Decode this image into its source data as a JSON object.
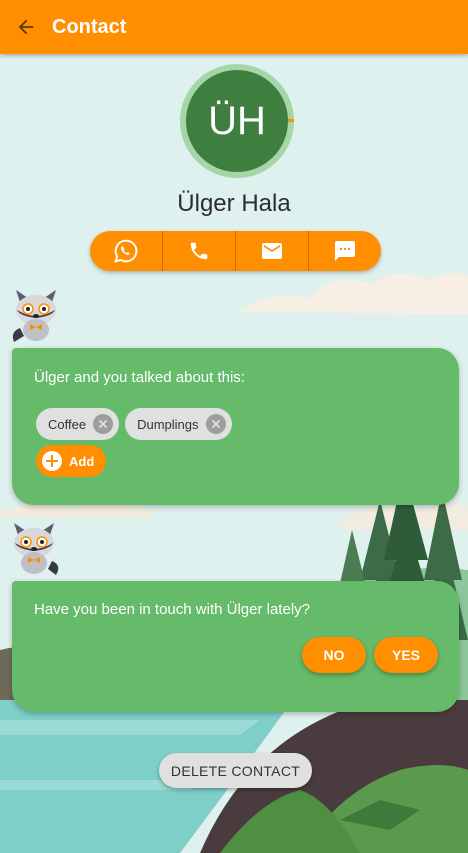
{
  "appbar": {
    "title": "Contact",
    "back_icon": "arrow-left-icon"
  },
  "contact": {
    "initials": "ÜH",
    "name": "Ülger Hala"
  },
  "actions": [
    {
      "icon": "whatsapp-icon"
    },
    {
      "icon": "phone-icon"
    },
    {
      "icon": "mail-icon"
    },
    {
      "icon": "sms-icon"
    }
  ],
  "topics_card": {
    "text": "Ülger and you talked about this:",
    "chips": [
      "Coffee",
      "Dumplings"
    ],
    "add_label": "Add"
  },
  "touch_card": {
    "text": "Have you been in touch with Ülger lately?",
    "no_label": "NO",
    "yes_label": "YES"
  },
  "delete_label": "DELETE CONTACT",
  "colors": {
    "accent": "#ff8f00",
    "card": "#66bb6a",
    "avatar": "#3e7f40",
    "avatar_ring": "#a5d6a7"
  }
}
